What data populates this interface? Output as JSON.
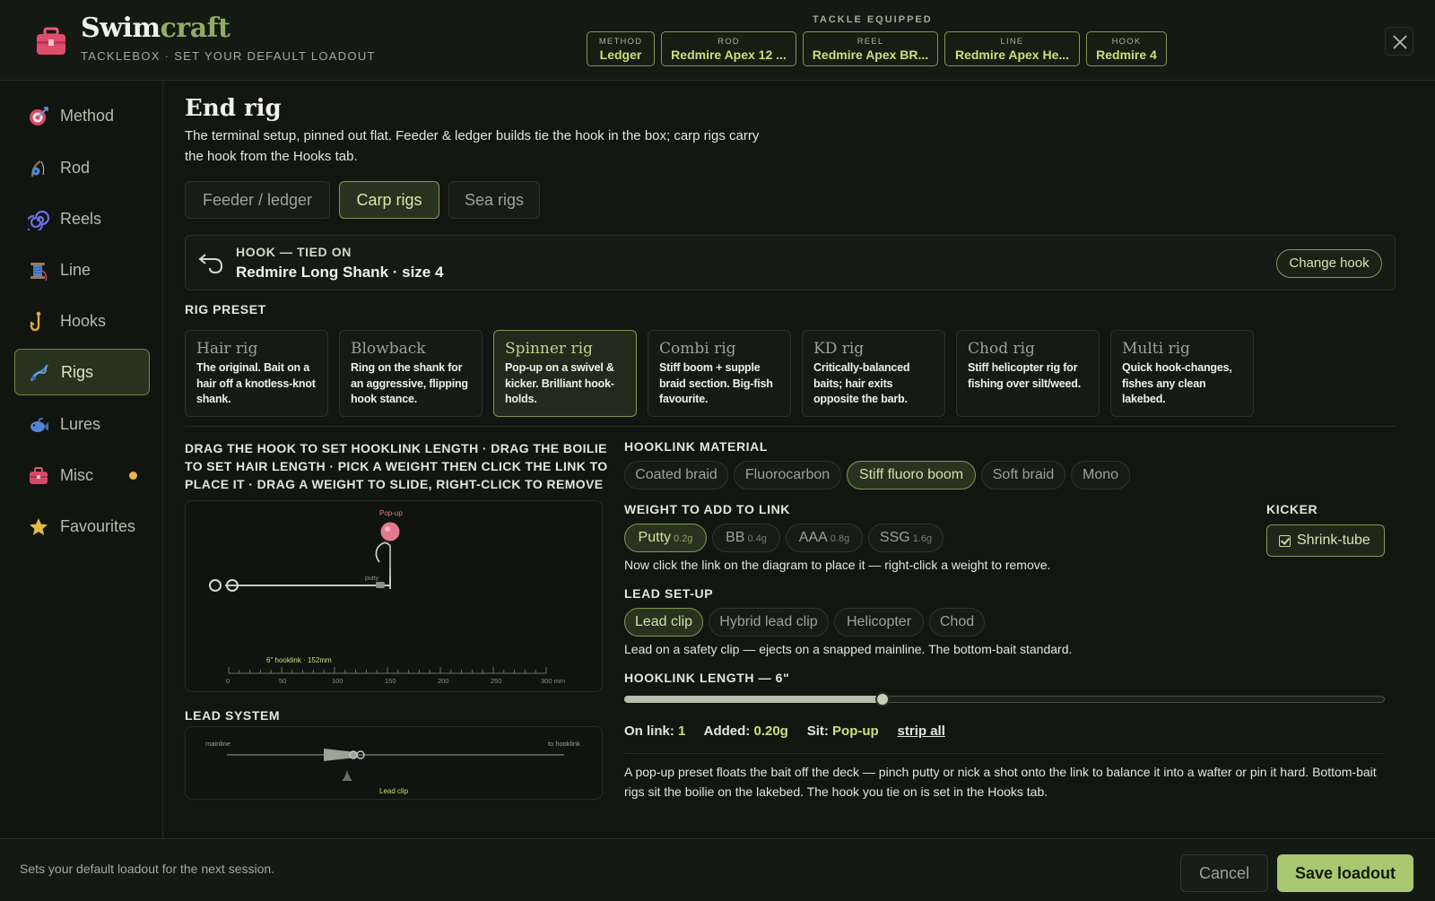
{
  "header": {
    "brand_a": "Swim",
    "brand_b": "craft",
    "subtitle": "TACKLEBOX · SET YOUR DEFAULT LOADOUT",
    "tackle_label": "TACKLE EQUIPPED",
    "chips": [
      {
        "key": "METHOD",
        "value": "Ledger"
      },
      {
        "key": "ROD",
        "value": "Redmire Apex 12 ..."
      },
      {
        "key": "REEL",
        "value": "Redmire Apex BR..."
      },
      {
        "key": "LINE",
        "value": "Redmire Apex He..."
      },
      {
        "key": "HOOK",
        "value": "Redmire 4"
      }
    ]
  },
  "sidebar": {
    "items": [
      {
        "label": "Method",
        "icon": "target-icon"
      },
      {
        "label": "Rod",
        "icon": "rod-icon"
      },
      {
        "label": "Reels",
        "icon": "reel-icon"
      },
      {
        "label": "Line",
        "icon": "spool-icon"
      },
      {
        "label": "Hooks",
        "icon": "hook-icon"
      },
      {
        "label": "Rigs",
        "icon": "rig-icon",
        "active": true
      },
      {
        "label": "Lures",
        "icon": "fish-icon"
      },
      {
        "label": "Misc",
        "icon": "toolbox-icon",
        "badge": true
      },
      {
        "label": "Favourites",
        "icon": "star-icon"
      }
    ]
  },
  "main": {
    "title": "End rig",
    "description": "The terminal setup, pinned out flat. Feeder & ledger builds tie the hook in the box; carp rigs carry the hook from the Hooks tab.",
    "tabs": [
      "Feeder / ledger",
      "Carp rigs",
      "Sea rigs"
    ],
    "active_tab": "Carp rigs",
    "hook": {
      "heading": "HOOK — TIED ON",
      "value": "Redmire Long Shank · size 4",
      "button": "Change hook"
    },
    "rig_preset_heading": "RIG PRESET",
    "presets": [
      {
        "name": "Hair rig",
        "desc": "The original. Bait on a hair off a knotless-knot shank."
      },
      {
        "name": "Blowback",
        "desc": "Ring on the shank for an aggressive, flipping hook stance."
      },
      {
        "name": "Spinner rig",
        "desc": "Pop-up on a swivel & kicker. Brilliant hook-holds.",
        "active": true
      },
      {
        "name": "Combi rig",
        "desc": "Stiff boom + supple braid section. Big-fish favourite."
      },
      {
        "name": "KD rig",
        "desc": "Critically-balanced baits; hair exits opposite the barb."
      },
      {
        "name": "Chod rig",
        "desc": "Stiff helicopter rig for fishing over silt/weed."
      },
      {
        "name": "Multi rig",
        "desc": "Quick hook-changes, fishes any clean lakebed."
      }
    ],
    "instructions": "DRAG THE HOOK TO SET HOOKLINK LENGTH · DRAG THE BOILIE TO SET HAIR LENGTH · PICK A WEIGHT THEN CLICK THE LINK TO PLACE IT · DRAG A WEIGHT TO SLIDE, RIGHT-CLICK TO REMOVE",
    "diagram": {
      "popup_label": "Pop-up",
      "putty_label": "putty",
      "length_label": "6\" hooklink · 152mm",
      "ruler_ticks": [
        "0",
        "50",
        "100",
        "150",
        "200",
        "250",
        "300 mm"
      ]
    },
    "lead_system_heading": "LEAD SYSTEM",
    "lead_diagram": {
      "mainline_label": "mainline",
      "hooklink_label": "to hooklink",
      "clip_label": "Lead clip"
    },
    "hooklink_material_heading": "HOOKLINK MATERIAL",
    "materials": [
      "Coated braid",
      "Fluorocarbon",
      "Stiff fluoro boom",
      "Soft braid",
      "Mono"
    ],
    "active_material": "Stiff fluoro boom",
    "weight_heading": "WEIGHT TO ADD TO LINK",
    "weights": [
      {
        "name": "Putty",
        "size": "0.2g",
        "active": true
      },
      {
        "name": "BB",
        "size": "0.4g"
      },
      {
        "name": "AAA",
        "size": "0.8g"
      },
      {
        "name": "SSG",
        "size": "1.6g"
      }
    ],
    "weight_note": "Now click the link on the diagram to place it — right-click a weight to remove.",
    "kicker_heading": "KICKER",
    "kicker_label": "Shrink-tube",
    "lead_setup_heading": "LEAD SET-UP",
    "lead_setups": [
      "Lead clip",
      "Hybrid lead clip",
      "Helicopter",
      "Chod"
    ],
    "active_lead_setup": "Lead clip",
    "lead_note": "Lead on a safety clip — ejects on a snapped mainline. The bottom-bait standard.",
    "hooklink_length_heading": "HOOKLINK LENGTH — 6\"",
    "hooklink_length_fraction": 0.34,
    "stats": {
      "on_link_label": "On link:",
      "on_link_value": "1",
      "added_label": "Added:",
      "added_value": "0.20g",
      "sit_label": "Sit:",
      "sit_value": "Pop-up",
      "strip_label": "strip all"
    },
    "footnote": "A pop-up preset floats the bait off the deck — pinch putty or nick a shot onto the link to balance it into a wafter or pin it hard. Bottom-bait rigs sit the boilie on the lakebed. The hook you tie on is set in the Hooks tab."
  },
  "footer": {
    "text": "Sets your default loadout for the next session.",
    "cancel": "Cancel",
    "save": "Save loadout"
  },
  "colors": {
    "accent": "#a9c86f",
    "accent_border": "#7f9a55",
    "value_green": "#c8e07c",
    "badge": "#e3b948",
    "popup_pink": "#e27a8e"
  }
}
